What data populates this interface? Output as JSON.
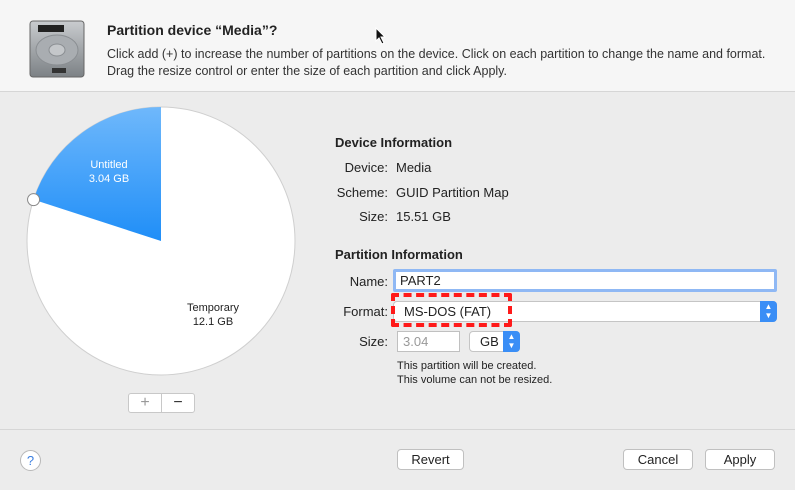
{
  "header": {
    "title": "Partition device “Media”?",
    "description": "Click add (+) to increase the number of partitions on the device. Click on each partition to change the name and format. Drag the resize control or enter the size of each partition and click Apply."
  },
  "pie": {
    "slices": [
      {
        "name": "Untitled",
        "size": "3.04 GB",
        "fraction": 0.2,
        "color": "#1f8ef8"
      },
      {
        "name": "Temporary",
        "size": "12.1 GB",
        "fraction": 0.8,
        "color": "#ffffff"
      }
    ],
    "add_label": "+",
    "remove_label": "−"
  },
  "device": {
    "heading": "Device Information",
    "device_label": "Device:",
    "device": "Media",
    "scheme_label": "Scheme:",
    "scheme": "GUID Partition Map",
    "size_label": "Size:",
    "size": "15.51 GB"
  },
  "partition": {
    "heading": "Partition Information",
    "name_label": "Name:",
    "name": "PART2",
    "format_label": "Format:",
    "format": "MS-DOS (FAT)",
    "size_label": "Size:",
    "size": "3.04",
    "unit": "GB",
    "note1": "This partition will be created.",
    "note2": "This volume can not be resized."
  },
  "footer": {
    "help": "?",
    "revert": "Revert",
    "cancel": "Cancel",
    "apply": "Apply"
  }
}
